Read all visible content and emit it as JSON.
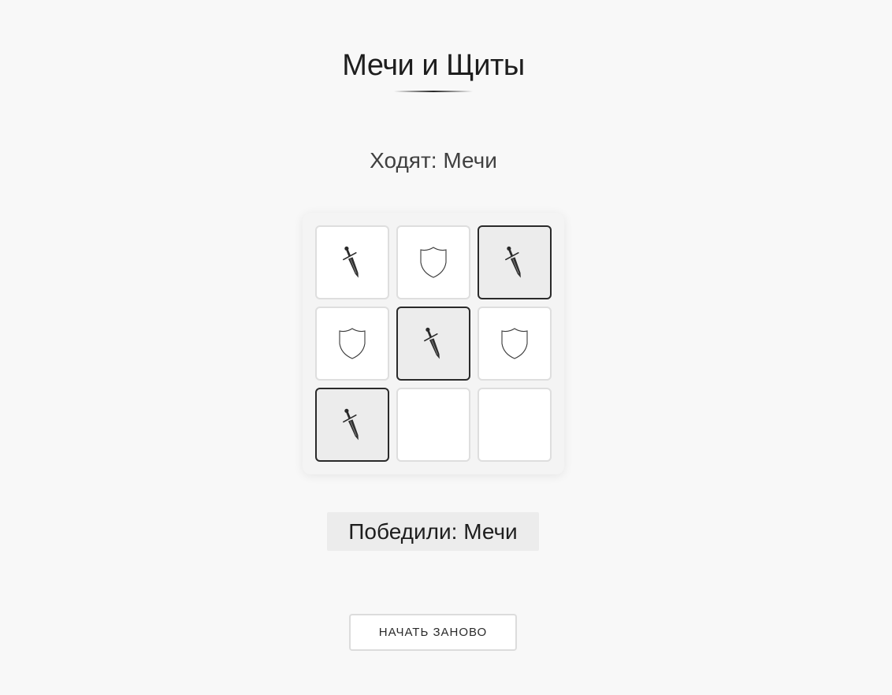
{
  "game": {
    "title": "Мечи и Щиты",
    "turn_text": "Ходят: Мечи",
    "winner_text": "Победили: Мечи",
    "restart_label": "НАЧАТЬ ЗАНОВО"
  },
  "board": {
    "rows": 3,
    "cols": 3,
    "cells": [
      {
        "piece": "sword",
        "win": false
      },
      {
        "piece": "shield",
        "win": false
      },
      {
        "piece": "sword",
        "win": true
      },
      {
        "piece": "shield",
        "win": false
      },
      {
        "piece": "sword",
        "win": true
      },
      {
        "piece": "shield",
        "win": false
      },
      {
        "piece": "sword",
        "win": true
      },
      {
        "piece": "empty",
        "win": false
      },
      {
        "piece": "empty",
        "win": false
      }
    ]
  },
  "icons": {
    "sword": "sword-icon",
    "shield": "shield-icon"
  },
  "colors": {
    "background": "#f8f8f8",
    "cell": "#ffffff",
    "win_cell": "#ececec",
    "win_border": "#2a2a2a",
    "text": "#1e1e1e"
  }
}
